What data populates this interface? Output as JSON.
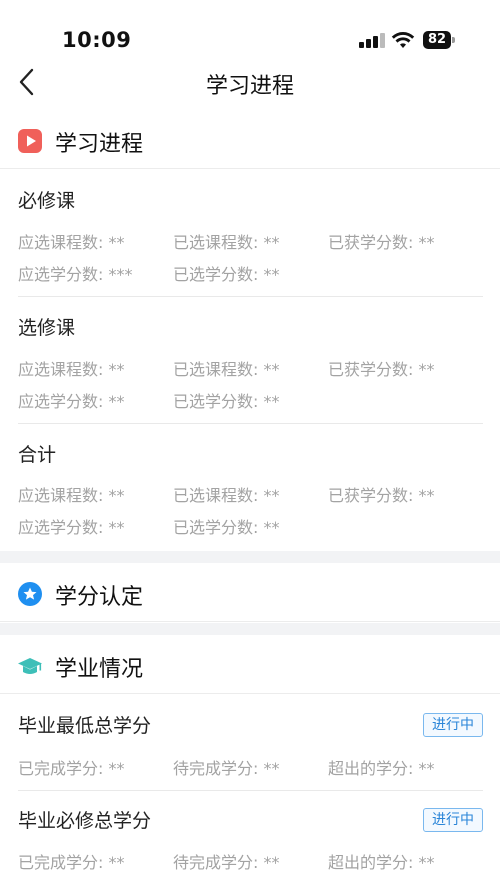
{
  "status_bar": {
    "time": "10:09",
    "battery": "82"
  },
  "nav": {
    "title": "学习进程"
  },
  "sections": {
    "progress": {
      "title": "学习进程",
      "groups": [
        {
          "title": "必修课",
          "row1": [
            "应选课程数: **",
            "已选课程数: **",
            "已获学分数: **"
          ],
          "row2": [
            "应选学分数: ***",
            "已选学分数: **"
          ]
        },
        {
          "title": "选修课",
          "row1": [
            "应选课程数: **",
            "已选课程数: **",
            "已获学分数: **"
          ],
          "row2": [
            "应选学分数: **",
            "已选学分数: **"
          ]
        },
        {
          "title": "合计",
          "row1": [
            "应选课程数: **",
            "已选课程数: **",
            "已获学分数: **"
          ],
          "row2": [
            "应选学分数: **",
            "已选学分数: **"
          ]
        }
      ]
    },
    "credit": {
      "title": "学分认定"
    },
    "academic": {
      "title": "学业情况",
      "items": [
        {
          "title": "毕业最低总学分",
          "badge": "进行中",
          "fields": [
            "已完成学分: **",
            "待完成学分: **",
            "超出的学分: **"
          ]
        },
        {
          "title": "毕业必修总学分",
          "badge": "进行中",
          "fields": [
            "已完成学分: **",
            "待完成学分: **",
            "超出的学分: **"
          ]
        }
      ]
    }
  },
  "colors": {
    "play_icon": "#f0605a",
    "star_icon": "#1f8ff0",
    "cap_icon": "#3dbfb8",
    "badge": "#2a85d8"
  }
}
